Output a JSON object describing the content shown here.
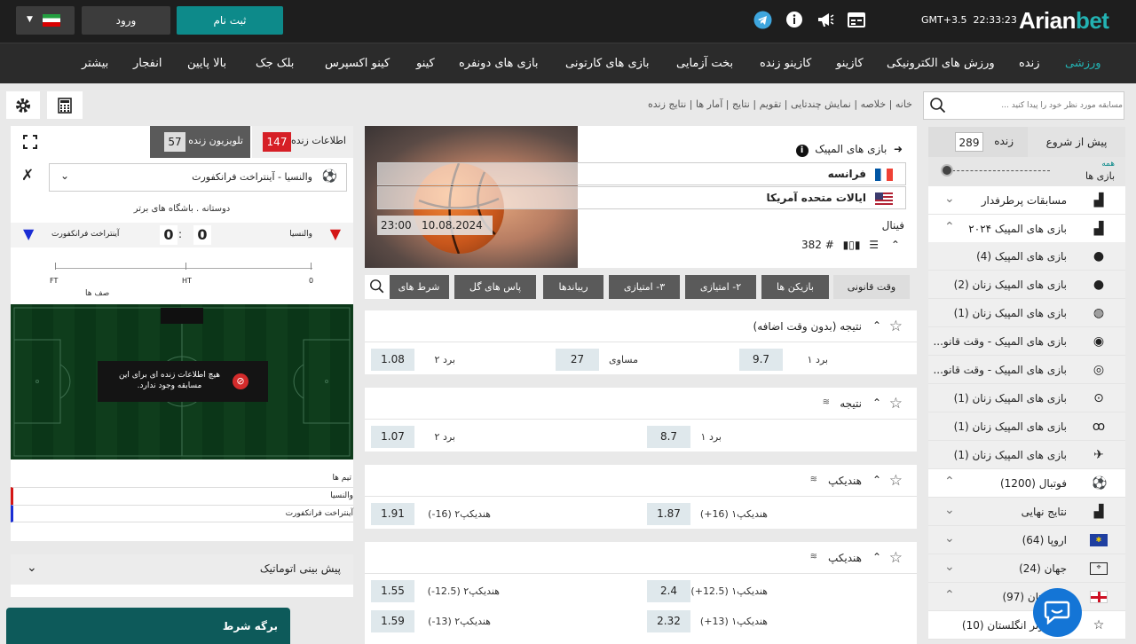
{
  "topbar": {
    "brand_part1": "Arian",
    "brand_part2": "bet",
    "clock": "22:33:23",
    "timezone": "GMT+3.5",
    "register": "ثبت نام",
    "login": "ورود",
    "colors": {
      "bg": "#1e1e1e",
      "teal": "#0d8a8a",
      "login_bg": "#3c3c3c"
    }
  },
  "nav": {
    "items": [
      "ورزشی",
      "زنده",
      "ورزش های الکترونیکی",
      "کازینو",
      "کازینو زنده",
      "بخت آزمایی",
      "بازی های کارتونی",
      "بازی های دونفره",
      "کینو",
      "کینو اکسپرس",
      "بلک جک",
      "بالا پایین",
      "انفجار",
      "بیشتر"
    ],
    "active_index": 0
  },
  "search": {
    "placeholder": "مسابقه مورد نظر خود را پیدا کنید ..."
  },
  "breadcrumbs": [
    "خانه",
    "خلاصه",
    "نمایش چندتایی",
    "تقویم",
    "نتایج",
    "آمار ها",
    "نتایج زنده"
  ],
  "sidebar": {
    "tab_prematch": "پیش از شروع",
    "tab_live": "زنده",
    "live_count": "289",
    "filter_top": "همه",
    "filter_bottom": "بازی ها",
    "items": [
      {
        "label": "مسابقات پرطرفدار",
        "icon": "podium-icon",
        "chev": "down",
        "level": 0
      },
      {
        "label": "بازی های المپیک ۲۰۲۴",
        "icon": "podium-icon",
        "chev": "up",
        "level": 0
      },
      {
        "label": "بازی های المپیک (4)",
        "icon": "basketball-icon",
        "level": 1
      },
      {
        "label": "بازی های المپیک زنان (2)",
        "icon": "basketball-icon",
        "level": 1
      },
      {
        "label": "بازی های المپیک زنان (1)",
        "icon": "volleyball-icon",
        "level": 1
      },
      {
        "label": "بازی های المپیک - وقت قانو...",
        "icon": "handball-icon",
        "level": 1
      },
      {
        "label": "بازی های المپیک - وقت قانو...",
        "icon": "waterpolo-icon",
        "level": 1
      },
      {
        "label": "بازی های المپیک زنان (1)",
        "icon": "weight-icon",
        "level": 1
      },
      {
        "label": "بازی های المپیک زنان (1)",
        "icon": "cycling-icon",
        "level": 1
      },
      {
        "label": "بازی های المپیک زنان (1)",
        "icon": "athletics-icon",
        "level": 1
      },
      {
        "label": "فوتبال (1200)",
        "icon": "football-icon",
        "chev": "up",
        "level": 0
      },
      {
        "label": "نتایج نهایی",
        "icon": "podium-icon",
        "chev": "down",
        "level": 1
      },
      {
        "label": "اروپا (64)",
        "icon": "eu-flag-icon",
        "chev": "down",
        "level": 1
      },
      {
        "label": "جهان (24)",
        "icon": "world-map-icon",
        "chev": "down",
        "level": 1
      },
      {
        "label": "انگلستان (97)",
        "icon": "england-flag-icon",
        "chev": "up",
        "level": 1
      },
      {
        "label": "لیگ برتر انگلستان (10)",
        "icon": "star-icon",
        "level": 2
      }
    ]
  },
  "event": {
    "title": "بازی های المپیک",
    "team1": "فرانسه",
    "team2": "ایالات متحده آمریکا",
    "date": "10.08.2024",
    "time": "23:00",
    "stage": "فینال",
    "market_count": "382 #"
  },
  "filter_tabs": [
    "وقت قانونی",
    "بازیکن ها",
    "۲- امتیازی",
    "۳- امتیازی",
    "ریباندها",
    "پاس های گل",
    "شرط های"
  ],
  "markets": [
    {
      "title": "نتیجه (بدون وقت اضافه)",
      "rows": [
        [
          {
            "label": "برد ۱",
            "odd": "9.7"
          },
          {
            "label": "مساوی",
            "odd": "27"
          },
          {
            "label": "برد ۲",
            "odd": "1.08"
          }
        ]
      ]
    },
    {
      "title": "نتیجه",
      "rows": [
        [
          {
            "label": "برد ۱",
            "odd": "8.7"
          },
          {
            "label": "برد ۲",
            "odd": "1.07"
          }
        ]
      ]
    },
    {
      "title": "هندیکپ",
      "rows": [
        [
          {
            "label": "هندیکپ۱ (16+)",
            "odd": "1.87"
          },
          {
            "label": "هندیکپ۲ (16-)",
            "odd": "1.91"
          }
        ]
      ]
    },
    {
      "title": "هندیکپ",
      "rows": [
        [
          {
            "label": "هندیکپ۱ (12.5+)",
            "odd": "2.4"
          },
          {
            "label": "هندیکپ۲ (12.5-)",
            "odd": "1.55"
          }
        ],
        [
          {
            "label": "هندیکپ۱ (13+)",
            "odd": "2.32"
          },
          {
            "label": "هندیکپ۲ (13-)",
            "odd": "1.59"
          }
        ]
      ]
    }
  ],
  "live": {
    "tab_info": "اطلاعات زنده",
    "info_count": "147",
    "tab_tv": "تلویزیون زنده",
    "tv_count": "57",
    "match_select": "والنسیا - آینتراخت فرانکفورت",
    "subtitle": "دوستانه . باشگاه های برتر",
    "home": "والنسیا",
    "away": "آینتراخت فرانکفورت",
    "score_home": "0",
    "score_away": "0",
    "timeline": [
      "FT",
      "HT",
      "0"
    ],
    "lineup": "صف ها",
    "no_info": "هیچ اطلاعات زنده ای برای این مسابقه وجود ندارد.",
    "teams_header": "تیم ها",
    "team_row1": "والنسیا",
    "team_row2": "آینتراخت فرانکفورت",
    "auto_predict": "پیش بینی اتوماتیک",
    "betslip": "برگه شرط"
  }
}
